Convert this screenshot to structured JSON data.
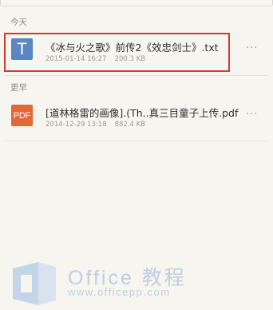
{
  "sections": {
    "today": "今天",
    "earlier": "更早"
  },
  "files": [
    {
      "icon": "txt-file-icon",
      "icon_text": "T",
      "name": "《冰与火之歌》前传2《效忠剑士》.txt",
      "date": "2015-01-14 16:27",
      "size": "200.3 KB"
    },
    {
      "icon": "pdf-file-icon",
      "icon_text": "PDF",
      "name": "[道林格雷的画像].(Th..真三目童子上传.pdf",
      "date": "2014-12-29 13:18",
      "size": "882.4 KB"
    }
  ],
  "more_label": "···",
  "watermark": {
    "title": "Office 教程",
    "url": "www.officepp.com"
  },
  "colors": {
    "background": "#f6f5f0",
    "txt_icon": "#5b86c3",
    "pdf_icon": "#e2673a",
    "highlight": "#d23a37",
    "watermark": "#b9c7dd"
  }
}
